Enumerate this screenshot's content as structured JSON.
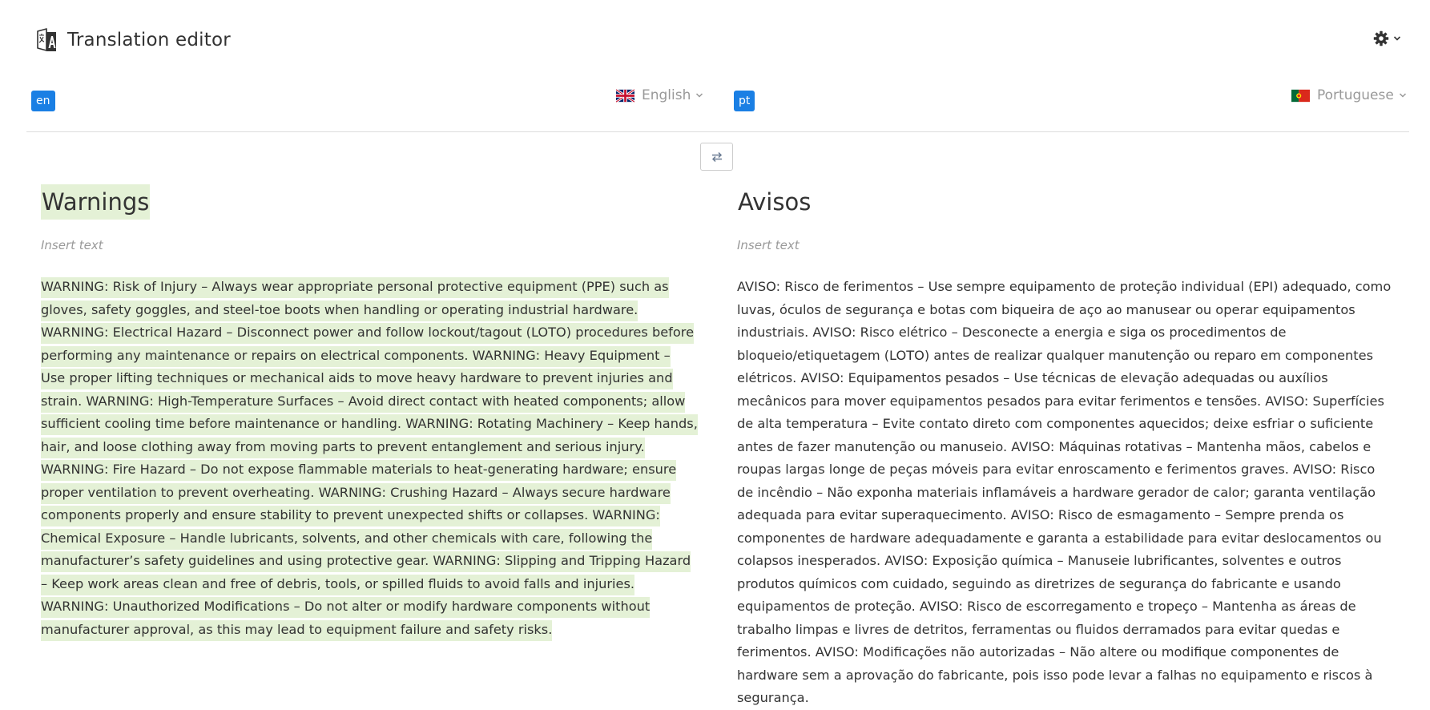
{
  "app": {
    "title": "Translation editor",
    "icon": "translate-icon"
  },
  "settings": {
    "icon": "gear-icon"
  },
  "source": {
    "code": "en",
    "language": "English",
    "flag": "uk-flag-icon",
    "title": "Warnings",
    "placeholder": "Insert text",
    "body": "WARNING: Risk of Injury – Always wear appropriate personal protective equipment (PPE) such as gloves, safety goggles, and steel-toe boots when handling or operating industrial hardware. WARNING: Electrical Hazard – Disconnect power and follow lockout/tagout (LOTO) procedures before performing any maintenance or repairs on electrical components. WARNING: Heavy Equipment – Use proper lifting techniques or mechanical aids to move heavy hardware to prevent injuries and strain. WARNING: High-Temperature Surfaces – Avoid direct contact with heated components; allow sufficient cooling time before maintenance or handling. WARNING: Rotating Machinery – Keep hands, hair, and loose clothing away from moving parts to prevent entanglement and serious injury. WARNING: Fire Hazard – Do not expose flammable materials to heat-generating hardware; ensure proper ventilation to prevent overheating. WARNING: Crushing Hazard – Always secure hardware components properly and ensure stability to prevent unexpected shifts or collapses. WARNING: Chemical Exposure – Handle lubricants, solvents, and other chemicals with care, following the manufacturer’s safety guidelines and using protective gear. WARNING: Slipping and Tripping Hazard – Keep work areas clean and free of debris, tools, or spilled fluids to avoid falls and injuries. WARNING: Unauthorized Modifications – Do not alter or modify hardware components without manufacturer approval, as this may lead to equipment failure and safety risks."
  },
  "target": {
    "code": "pt",
    "language": "Portuguese",
    "flag": "portugal-flag-icon",
    "title": "Avisos",
    "placeholder": "Insert text",
    "body": "AVISO: Risco de ferimentos – Use sempre equipamento de proteção individual (EPI) adequado, como luvas, óculos de segurança e botas com biqueira de aço ao manusear ou operar equipamentos industriais. AVISO: Risco elétrico – Desconecte a energia e siga os procedimentos de bloqueio/etiquetagem (LOTO) antes de realizar qualquer manutenção ou reparo em componentes elétricos. AVISO: Equipamentos pesados – Use técnicas de elevação adequadas ou auxílios mecânicos para mover equipamentos pesados para evitar ferimentos e tensões. AVISO: Superfícies de alta temperatura – Evite contato direto com componentes aquecidos; deixe esfriar o suficiente antes de fazer manutenção ou manuseio. AVISO: Máquinas rotativas – Mantenha mãos, cabelos e roupas largas longe de peças móveis para evitar enroscamento e ferimentos graves. AVISO: Risco de incêndio – Não exponha materiais inflamáveis a hardware gerador de calor; garanta ventilação adequada para evitar superaquecimento. AVISO: Risco de esmagamento – Sempre prenda os componentes de hardware adequadamente e garanta a estabilidade para evitar deslocamentos ou colapsos inesperados. AVISO: Exposição química – Manuseie lubrificantes, solventes e outros produtos químicos com cuidado, seguindo as diretrizes de segurança do fabricante e usando equipamentos de proteção. AVISO: Risco de escorregamento e tropeço – Mantenha as áreas de trabalho limpas e livres de detritos, ferramentas ou fluidos derramados para evitar quedas e ferimentos. AVISO: Modificações não autorizadas – Não altere ou modifique componentes de hardware sem a aprovação do fabricante, pois isso pode levar a falhas no equipamento e riscos à segurança."
  },
  "swap": {
    "icon": "swap-arrows-icon"
  },
  "colors": {
    "accent": "#1a7fe4",
    "highlight": "#e4f1d6",
    "muted": "#999999"
  }
}
